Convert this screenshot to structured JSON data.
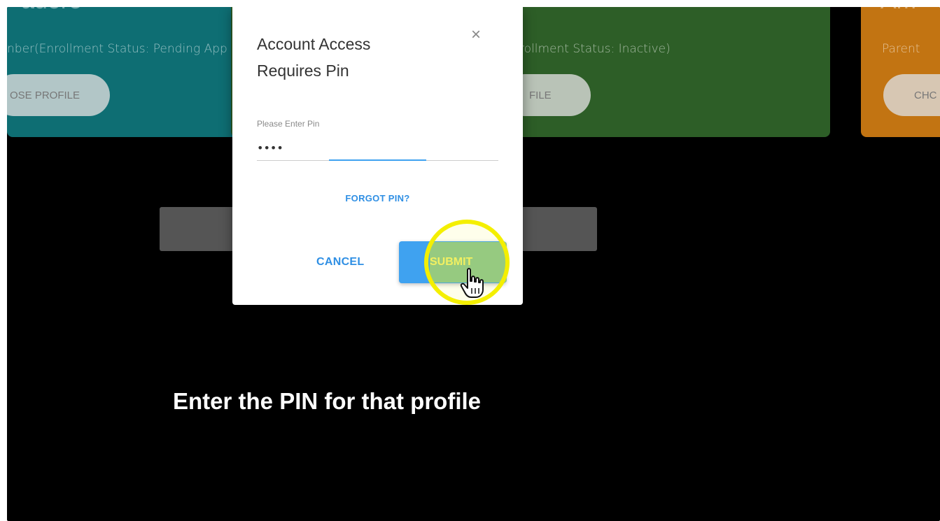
{
  "background_cards": {
    "left": {
      "title": "adore",
      "subtitle": "nber(Enrollment Status: Pending App",
      "button_label": "OSE PROFILE"
    },
    "middle": {
      "subtitle": "rollment Status: Inactive)",
      "button_label": "FILE"
    },
    "right": {
      "title": "Am",
      "subtitle": "Parent",
      "button_label": "CHC"
    }
  },
  "dialog": {
    "title": "Account Access Requires Pin",
    "close_glyph": "×",
    "pin_label": "Please Enter Pin",
    "pin_value": "••••",
    "forgot_label": "FORGOT PIN?",
    "cancel_label": "CANCEL",
    "submit_label": "SUBMIT"
  },
  "caption": "Enter the PIN for that profile",
  "colors": {
    "teal_card": "#0e6e73",
    "green_card": "#2d5e27",
    "orange_card": "#c27412",
    "accent_blue": "#3fa2f0",
    "highlight_yellow": "#f4ef00"
  },
  "icons": {
    "close": "close-icon",
    "cursor": "pointer-hand-icon"
  }
}
